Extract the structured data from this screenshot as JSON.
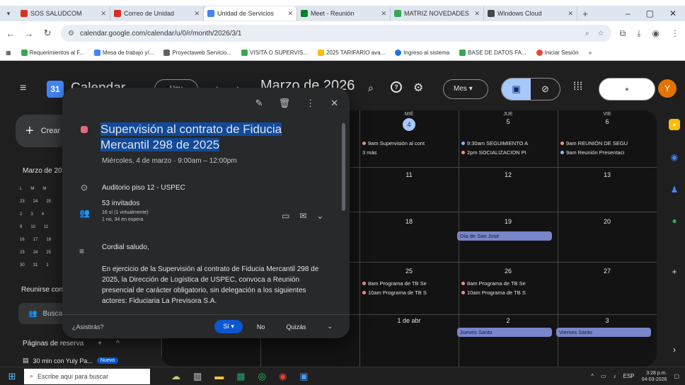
{
  "browser": {
    "tabs": [
      {
        "title": "SOS SALUDCOM",
        "color": "#d93025"
      },
      {
        "title": "Correo de Unidad",
        "color": "#d93025"
      },
      {
        "title": "Unidad de Servicios",
        "color": "#4285f4",
        "active": true
      },
      {
        "title": "Meet - Reunión",
        "color": "#00832d"
      },
      {
        "title": "MATRIZ NOVEDADES",
        "color": "#34a853"
      },
      {
        "title": "Windows Cloud",
        "color": "#444746"
      }
    ],
    "window_controls": [
      "–",
      "▢",
      "✕"
    ],
    "url": "calendar.google.com/calendar/u/0/r/month/2026/3/1",
    "bookmarks": [
      "Requerimientos al F...",
      "Mesa de trabajo y/...",
      "Proyectaweb Servicio...",
      "VISITA O SUPERVIS...",
      "2025 TARIFARIO ava...",
      "Ingreso al sistema",
      "BASE DE DATOS FA...",
      "Iniciar Sesión"
    ]
  },
  "calendar": {
    "app_name": "Calendar",
    "today_button": "Hoy",
    "month_title": "Marzo de 2026",
    "view_select": "Mes",
    "create_label": "Crear",
    "mini_title": "Marzo de 2026",
    "mini_rows": [
      [
        "L",
        "M",
        "M",
        "J",
        "V"
      ],
      [
        "23",
        "24",
        "25",
        "26",
        "27"
      ],
      [
        "2",
        "3",
        "4",
        "5",
        "6"
      ],
      [
        "9",
        "10",
        "11",
        "12",
        "13"
      ],
      [
        "16",
        "17",
        "18",
        "19",
        "20"
      ],
      [
        "23",
        "24",
        "25",
        "26",
        "27"
      ],
      [
        "30",
        "31",
        "1",
        "2",
        "3"
      ]
    ],
    "meet_title": "Reunirse con...",
    "people_search": "Buscar",
    "booking_title": "Páginas de reserva",
    "booking_plus": "+",
    "booking_caret": "^",
    "booking_item": "30 min con Yuly Pa...",
    "booking_badge": "Nuevo",
    "columns": [
      {
        "dow": "MIÉ",
        "num": "4",
        "today": true
      },
      {
        "dow": "JUE",
        "num": "5"
      },
      {
        "dow": "VIE",
        "num": "6"
      }
    ],
    "week2_nums": [
      "11",
      "12",
      "13"
    ],
    "week3_nums": [
      "18",
      "19",
      "20"
    ],
    "week4_nums": [
      "25",
      "26",
      "27"
    ],
    "week5_nums": [
      "1 de abr",
      "2",
      "3"
    ],
    "events": {
      "wed4_a": "9am Supervisión al cont",
      "wed4_more": "3 más",
      "thu5_a": "9:30am SEGUIMIENTO A",
      "thu5_b": "2pm SOCIALIZACION PI",
      "fri6_a": "9am REUNIÓN DE SEGU",
      "fri6_b": "9am Reunión Presentaci",
      "thu19_allday": "Día de San José",
      "wed25_a": "8am Programa de TB Se",
      "wed25_b": "10am Programa de TB S",
      "thu26_a": "8am Programa de TB Se",
      "thu26_b": "10am Programa de TB S",
      "thu2_allday": "Jueves Santo",
      "fri3_allday": "Viernes Santo"
    }
  },
  "popover": {
    "title": "Supervisión al contrato de Fiducia Mercantil 298 de 2025",
    "when": "Miércoles, 4 de marzo · 9:00am – 12:00pm",
    "location": "Auditorio piso 12 - USPEC",
    "guests": "53 invitados",
    "guests_detail": "16 sí (1 virtualmente)",
    "guests_detail2": "1 no, 34 en espera",
    "greeting": "Cordial saludo,",
    "description": "En ejercicio de la Supervisión al contrato de Fiducia Mercantil 298 de 2025, la Dirección de Logística de USPEC, convoca a Reunión presencial de carácter obligatorio, sin delegación a los siguientes actores: Fiduciaria La Previsora S.A.",
    "rsvp_question": "¿Asistirás?",
    "rsvp_yes": "Sí",
    "rsvp_no": "No",
    "rsvp_maybe": "Quizás"
  },
  "taskbar": {
    "search_placeholder": "Escribe aquí para buscar",
    "lang": "ESP",
    "time": "3:28 p.m.",
    "date": "04-03-2026"
  }
}
